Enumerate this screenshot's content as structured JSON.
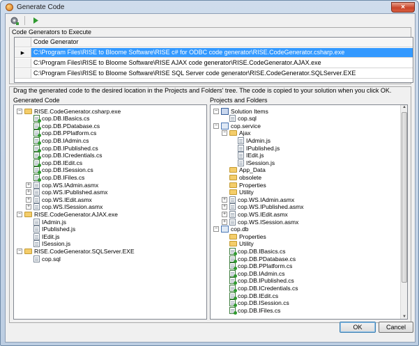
{
  "window": {
    "title": "Generate Code",
    "close_glyph": "×"
  },
  "toolbar": {
    "generate_icon": "gear-icon",
    "run_icon": "play-icon"
  },
  "generators_group": {
    "title": "Code Generators to Execute",
    "column_header": "Code Generator",
    "rows": [
      {
        "value": "C:\\Program Files\\RISE to Bloome Software\\RISE c# for ODBC code generator\\RISE.CodeGenerator.csharp.exe",
        "selected": true
      },
      {
        "value": "C:\\Program Files\\RISE to Bloome Software\\RISE AJAX code generator\\RISE.CodeGenerator.AJAX.exe",
        "selected": false
      },
      {
        "value": "C:\\Program Files\\RISE to Bloome Software\\RISE SQL Server code generator\\RISE.CodeGenerator.SQLServer.EXE",
        "selected": false
      }
    ]
  },
  "instructions": "Drag the generated code to the desired location in the Projects and Folders' tree. The code is copied to your solution when you click OK.",
  "generated_code": {
    "title": "Generated Code",
    "items": [
      {
        "label": "RISE.CodeGenerator.csharp.exe",
        "level": 0,
        "icon": "folder",
        "expander": "-"
      },
      {
        "label": "cop.DB.IBasics.cs",
        "level": 1,
        "icon": "cs",
        "expander": ""
      },
      {
        "label": "cop.DB.PDatabase.cs",
        "level": 1,
        "icon": "cs",
        "expander": ""
      },
      {
        "label": "cop.DB.PPlatform.cs",
        "level": 1,
        "icon": "cs",
        "expander": ""
      },
      {
        "label": "cop.DB.IAdmin.cs",
        "level": 1,
        "icon": "cs",
        "expander": ""
      },
      {
        "label": "cop.DB.IPublished.cs",
        "level": 1,
        "icon": "cs",
        "expander": ""
      },
      {
        "label": "cop.DB.ICredentials.cs",
        "level": 1,
        "icon": "cs",
        "expander": ""
      },
      {
        "label": "cop.DB.IEdit.cs",
        "level": 1,
        "icon": "cs",
        "expander": ""
      },
      {
        "label": "cop.DB.ISession.cs",
        "level": 1,
        "icon": "cs",
        "expander": ""
      },
      {
        "label": "cop.DB.IFiles.cs",
        "level": 1,
        "icon": "cs",
        "expander": ""
      },
      {
        "label": "cop.WS.IAdmin.asmx",
        "level": 1,
        "icon": "file",
        "expander": "+"
      },
      {
        "label": "cop.WS.IPublished.asmx",
        "level": 1,
        "icon": "file",
        "expander": "+"
      },
      {
        "label": "cop.WS.IEdit.asmx",
        "level": 1,
        "icon": "file",
        "expander": "+"
      },
      {
        "label": "cop.WS.ISession.asmx",
        "level": 1,
        "icon": "file",
        "expander": "+"
      },
      {
        "label": "RISE.CodeGenerator.AJAX.exe",
        "level": 0,
        "icon": "folder",
        "expander": "-"
      },
      {
        "label": "IAdmin.js",
        "level": 1,
        "icon": "file",
        "expander": ""
      },
      {
        "label": "IPublished.js",
        "level": 1,
        "icon": "file",
        "expander": ""
      },
      {
        "label": "IEdit.js",
        "level": 1,
        "icon": "file",
        "expander": ""
      },
      {
        "label": "ISession.js",
        "level": 1,
        "icon": "file",
        "expander": ""
      },
      {
        "label": "RISE.CodeGenerator.SQLServer.EXE",
        "level": 0,
        "icon": "folder",
        "expander": "-"
      },
      {
        "label": "cop.sql",
        "level": 1,
        "icon": "file",
        "expander": ""
      }
    ]
  },
  "projects": {
    "title": "Projects and Folders",
    "items": [
      {
        "label": "Solution Items",
        "level": 0,
        "icon": "solution",
        "expander": "-"
      },
      {
        "label": "cop.sql",
        "level": 1,
        "icon": "file",
        "expander": ""
      },
      {
        "label": "cop.service",
        "level": 0,
        "icon": "proj",
        "expander": "-"
      },
      {
        "label": "Ajax",
        "level": 1,
        "icon": "folder",
        "expander": "-"
      },
      {
        "label": "IAdmin.js",
        "level": 2,
        "icon": "file",
        "expander": ""
      },
      {
        "label": "IPublished.js",
        "level": 2,
        "icon": "file",
        "expander": ""
      },
      {
        "label": "IEdit.js",
        "level": 2,
        "icon": "file",
        "expander": ""
      },
      {
        "label": "ISession.js",
        "level": 2,
        "icon": "file",
        "expander": ""
      },
      {
        "label": "App_Data",
        "level": 1,
        "icon": "folder",
        "expander": ""
      },
      {
        "label": "obsolete",
        "level": 1,
        "icon": "folder",
        "expander": ""
      },
      {
        "label": "Properties",
        "level": 1,
        "icon": "folder",
        "expander": ""
      },
      {
        "label": "Utility",
        "level": 1,
        "icon": "folder",
        "expander": ""
      },
      {
        "label": "cop.WS.IAdmin.asmx",
        "level": 1,
        "icon": "file",
        "expander": "+"
      },
      {
        "label": "cop.WS.IPublished.asmx",
        "level": 1,
        "icon": "file",
        "expander": "+"
      },
      {
        "label": "cop.WS.IEdit.asmx",
        "level": 1,
        "icon": "file",
        "expander": "+"
      },
      {
        "label": "cop.WS.ISession.asmx",
        "level": 1,
        "icon": "file",
        "expander": "+"
      },
      {
        "label": "cop.db",
        "level": 0,
        "icon": "proj",
        "expander": "-"
      },
      {
        "label": "Properties",
        "level": 1,
        "icon": "folder",
        "expander": ""
      },
      {
        "label": "Utility",
        "level": 1,
        "icon": "folder",
        "expander": ""
      },
      {
        "label": "cop.DB.IBasics.cs",
        "level": 1,
        "icon": "cs",
        "expander": ""
      },
      {
        "label": "cop.DB.PDatabase.cs",
        "level": 1,
        "icon": "cs",
        "expander": ""
      },
      {
        "label": "cop.DB.PPlatform.cs",
        "level": 1,
        "icon": "cs",
        "expander": ""
      },
      {
        "label": "cop.DB.IAdmin.cs",
        "level": 1,
        "icon": "cs",
        "expander": ""
      },
      {
        "label": "cop.DB.IPublished.cs",
        "level": 1,
        "icon": "cs",
        "expander": ""
      },
      {
        "label": "cop.DB.ICredentials.cs",
        "level": 1,
        "icon": "cs",
        "expander": ""
      },
      {
        "label": "cop.DB.IEdit.cs",
        "level": 1,
        "icon": "cs",
        "expander": ""
      },
      {
        "label": "cop.DB.ISession.cs",
        "level": 1,
        "icon": "cs",
        "expander": ""
      },
      {
        "label": "cop.DB.IFiles.cs",
        "level": 1,
        "icon": "cs",
        "expander": ""
      }
    ]
  },
  "buttons": {
    "ok": "OK",
    "cancel": "Cancel"
  }
}
